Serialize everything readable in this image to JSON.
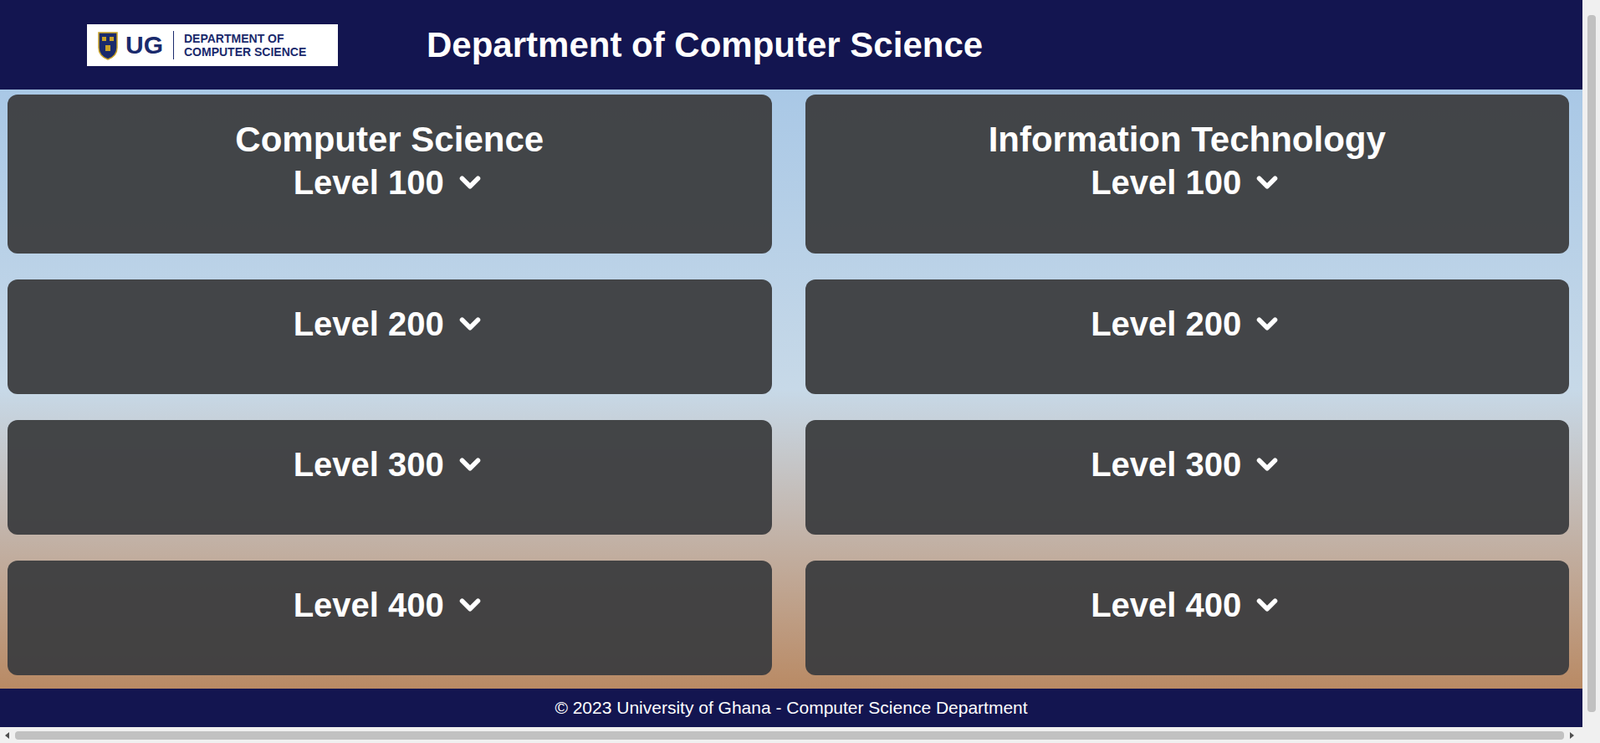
{
  "header": {
    "logo": {
      "mark": "UG",
      "line1": "DEPARTMENT OF",
      "line2": "COMPUTER SCIENCE"
    },
    "title": "Department of Computer Science"
  },
  "programmes": [
    {
      "title": "Computer Science",
      "levels": [
        {
          "label": "Level 100",
          "expanded": false
        },
        {
          "label": "Level 200",
          "expanded": false
        },
        {
          "label": "Level 300",
          "expanded": false
        },
        {
          "label": "Level 400",
          "expanded": false
        }
      ]
    },
    {
      "title": "Information Technology",
      "levels": [
        {
          "label": "Level 100",
          "expanded": false
        },
        {
          "label": "Level 200",
          "expanded": false
        },
        {
          "label": "Level 300",
          "expanded": false
        },
        {
          "label": "Level 400",
          "expanded": false
        }
      ]
    }
  ],
  "footer": {
    "text": "© 2023 University of Ghana - Computer Science Department"
  }
}
